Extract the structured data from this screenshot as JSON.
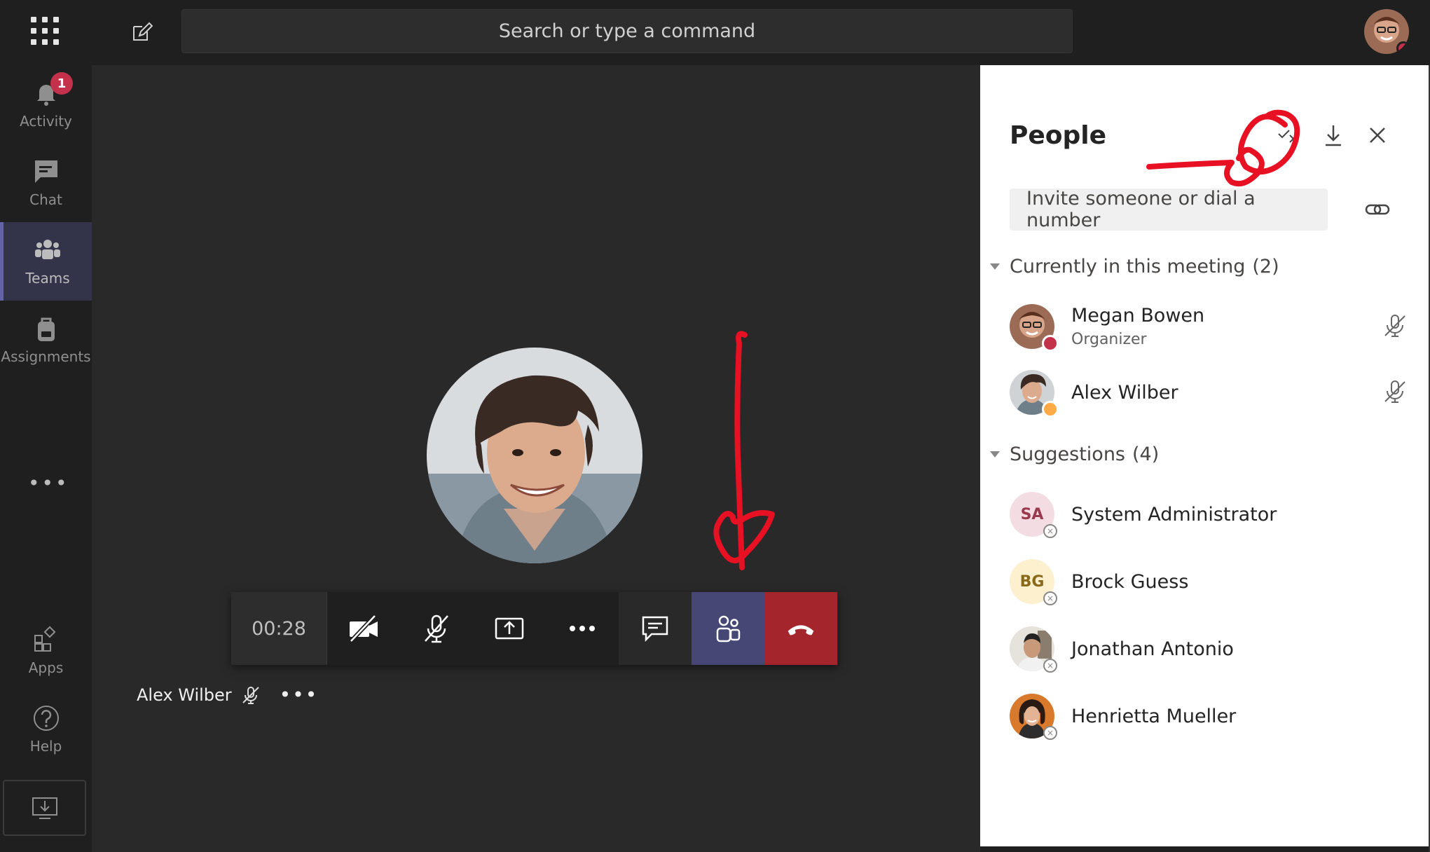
{
  "topbar": {
    "search_placeholder": "Search or type a command"
  },
  "rail": {
    "activity": {
      "label": "Activity",
      "badge": "1"
    },
    "chat": {
      "label": "Chat"
    },
    "teams": {
      "label": "Teams"
    },
    "assignments": {
      "label": "Assignments"
    },
    "more": "•••",
    "apps": {
      "label": "Apps"
    },
    "help": {
      "label": "Help"
    }
  },
  "call": {
    "timer": "00:28",
    "participant_name": "Alex Wilber",
    "more_dots": "•••"
  },
  "people_panel": {
    "title": "People",
    "invite_placeholder": "Invite someone or dial a number",
    "current_section": {
      "label": "Currently in this meeting",
      "count": "(2)"
    },
    "current": [
      {
        "name": "Megan Bowen",
        "role": "Organizer",
        "status": "busy"
      },
      {
        "name": "Alex Wilber",
        "role": "",
        "status": "away"
      }
    ],
    "suggestions_section": {
      "label": "Suggestions",
      "count": "(4)"
    },
    "suggestions": [
      {
        "name": "System Administrator",
        "initials": "SA"
      },
      {
        "name": "Brock Guess",
        "initials": "BG"
      },
      {
        "name": "Jonathan Antonio",
        "initials": ""
      },
      {
        "name": "Henrietta Mueller",
        "initials": ""
      }
    ]
  },
  "colors": {
    "accent": "#6264a7",
    "people_button": "#464775",
    "hangup": "#a4262c",
    "busy": "#c4314b",
    "away": "#ffaa44",
    "annotation": "#e81123"
  }
}
